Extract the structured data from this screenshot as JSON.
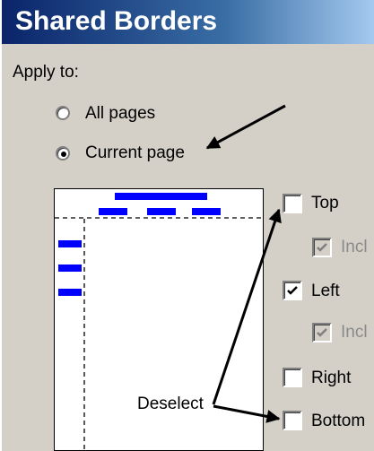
{
  "window": {
    "title": "Shared Borders"
  },
  "apply_to": {
    "label": "Apply to:",
    "options": [
      {
        "label": "All pages",
        "selected": false
      },
      {
        "label": "Current page",
        "selected": true
      }
    ]
  },
  "borders": {
    "top": {
      "label": "Top",
      "checked": false
    },
    "top_include": {
      "label": "Incl",
      "checked": true,
      "disabled": true
    },
    "left": {
      "label": "Left",
      "checked": true
    },
    "left_include": {
      "label": "Incl",
      "checked": true,
      "disabled": true
    },
    "right": {
      "label": "Right",
      "checked": false
    },
    "bottom": {
      "label": "Bottom",
      "checked": false
    }
  },
  "annotation": {
    "text": "Deselect"
  },
  "colors": {
    "accent": "#0000ff",
    "title_bar": "#0a246a",
    "dialog_bg": "#d4d0c8"
  }
}
